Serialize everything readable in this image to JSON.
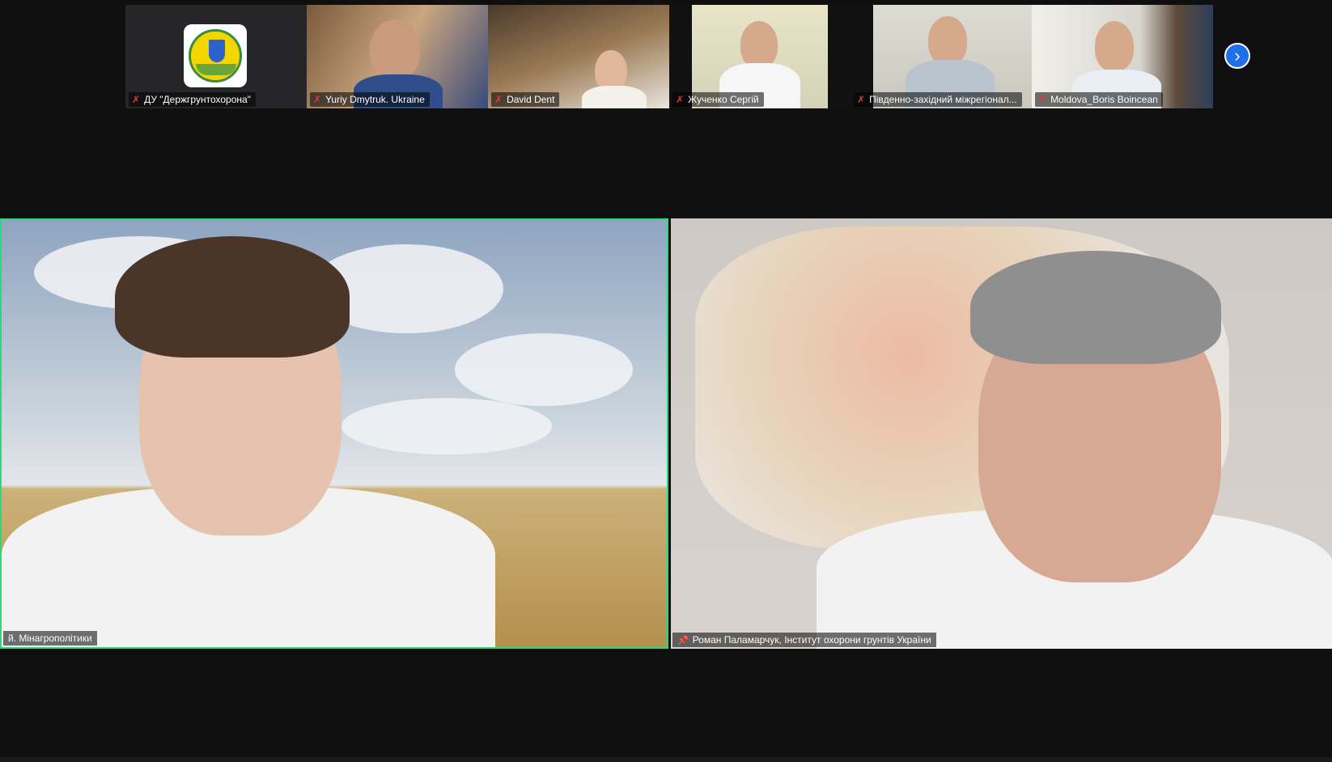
{
  "thumbnails": [
    {
      "name": "ДУ \"Держгрунтохорона\"",
      "muted": true
    },
    {
      "name": "Yuriy Dmytruk. Ukraine",
      "muted": true
    },
    {
      "name": "David Dent",
      "muted": true
    },
    {
      "name": "Жученко Сергій",
      "muted": true
    },
    {
      "name": "Південно-західний міжрегіонал...",
      "muted": true
    },
    {
      "name": "Moldova_Boris Boincean",
      "muted": true
    }
  ],
  "main_tiles": [
    {
      "name": "й. Мінагрополітики",
      "active_speaker": true
    },
    {
      "name": "Роман Паламарчук, Інститут охорони грунтів України",
      "pinned": true
    }
  ],
  "icons": {
    "mic_muted": "mic-muted-icon",
    "pin": "pin-icon",
    "next": "chevron-right-icon"
  },
  "colors": {
    "active_speaker_border": "#2bd97c",
    "next_button": "#1f6feb",
    "muted_mic": "#e5383b"
  }
}
